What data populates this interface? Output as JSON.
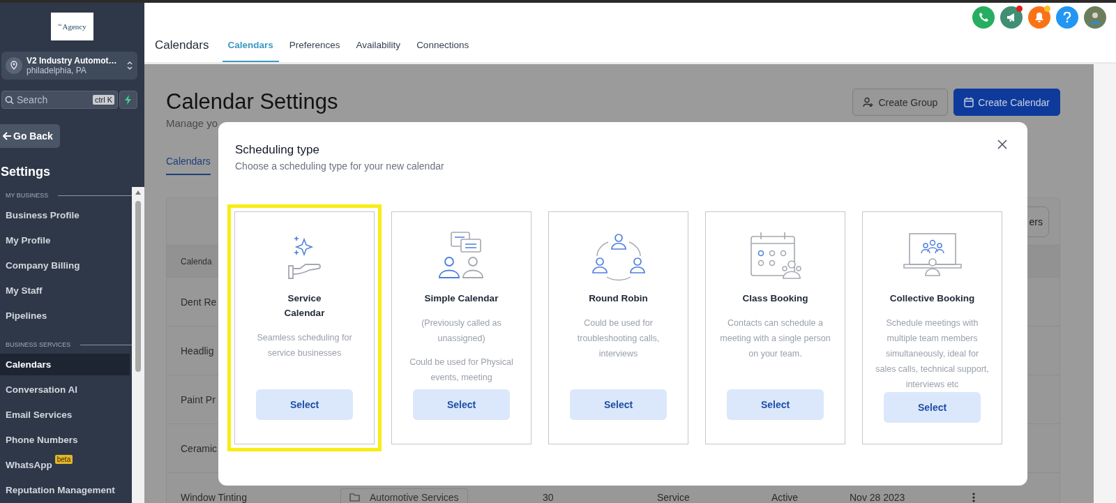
{
  "sidebar": {
    "logo": "$^{the}$Agency",
    "location": {
      "name": "V2 Industry Automot…",
      "city": "philadelphia, PA"
    },
    "search": {
      "placeholder": "Search",
      "shortcut": "ctrl K"
    },
    "back": "Go Back",
    "title": "Settings",
    "sections": [
      {
        "heading": "MY BUSINESS",
        "items": [
          {
            "label": "Business Profile",
            "selected": false
          },
          {
            "label": "My Profile",
            "selected": false
          },
          {
            "label": "Company Billing",
            "selected": false
          },
          {
            "label": "My Staff",
            "selected": false
          },
          {
            "label": "Pipelines",
            "selected": false
          }
        ]
      },
      {
        "heading": "BUSINESS SERVICES",
        "items": [
          {
            "label": "Calendars",
            "selected": true
          },
          {
            "label": "Conversation AI",
            "selected": false
          },
          {
            "label": "Email Services",
            "selected": false
          },
          {
            "label": "Phone Numbers",
            "selected": false
          },
          {
            "label": "WhatsApp",
            "selected": false,
            "badge": "beta"
          },
          {
            "label": "Reputation Management",
            "selected": false
          }
        ]
      }
    ]
  },
  "header": {
    "title": "Calendars",
    "tabs": [
      {
        "label": "Calendars",
        "selected": true
      },
      {
        "label": "Preferences",
        "selected": false
      },
      {
        "label": "Availability",
        "selected": false
      },
      {
        "label": "Connections",
        "selected": false
      }
    ]
  },
  "page": {
    "title": "Calendar Settings",
    "subtitle": "Manage yo",
    "buttons": [
      {
        "label": "Create Group",
        "kind": "secondary"
      },
      {
        "label": "Create Calendar",
        "kind": "primary"
      }
    ],
    "tabs": [
      {
        "label": "Calendars",
        "selected": true
      }
    ],
    "filter_button": "ers",
    "table": {
      "columns": [
        "Calenda"
      ],
      "rows": [
        {
          "cells": [
            "Dent Re"
          ]
        },
        {
          "cells": [
            "Headlig"
          ]
        },
        {
          "cells": [
            "Paint Pr"
          ]
        },
        {
          "cells": [
            "Ceramic"
          ]
        },
        {
          "cells": [
            "Window Tinting",
            "Automotive Services",
            "30",
            "Service",
            "Active",
            "Nov 28 2023"
          ]
        }
      ]
    }
  },
  "modal": {
    "title": "Scheduling type",
    "subtitle": "Choose a scheduling type for your new calendar",
    "cards": [
      {
        "kind": "service",
        "title": "Service\nCalendar",
        "paragraphs": [
          "Seamless scheduling for service businesses"
        ],
        "button": "Select",
        "selected": true
      },
      {
        "kind": "simple",
        "title": "Simple Calendar",
        "paragraphs": [
          "(Previously called as unassigned)",
          "Could be used for Physical events, meeting"
        ],
        "button": "Select",
        "selected": false
      },
      {
        "kind": "robin",
        "title": "Round Robin",
        "paragraphs": [
          "Could be used for troubleshooting calls, interviews"
        ],
        "button": "Select",
        "selected": false
      },
      {
        "kind": "class",
        "title": "Class Booking",
        "paragraphs": [
          "Contacts can schedule a meeting with a single person on your team."
        ],
        "button": "Select",
        "selected": false
      },
      {
        "kind": "collective",
        "title": "Collective Booking",
        "paragraphs": [
          "Schedule meetings with multiple team members simultaneously, ideal for sales calls, technical support, interviews etc"
        ],
        "button": "Select",
        "selected": false
      }
    ]
  }
}
